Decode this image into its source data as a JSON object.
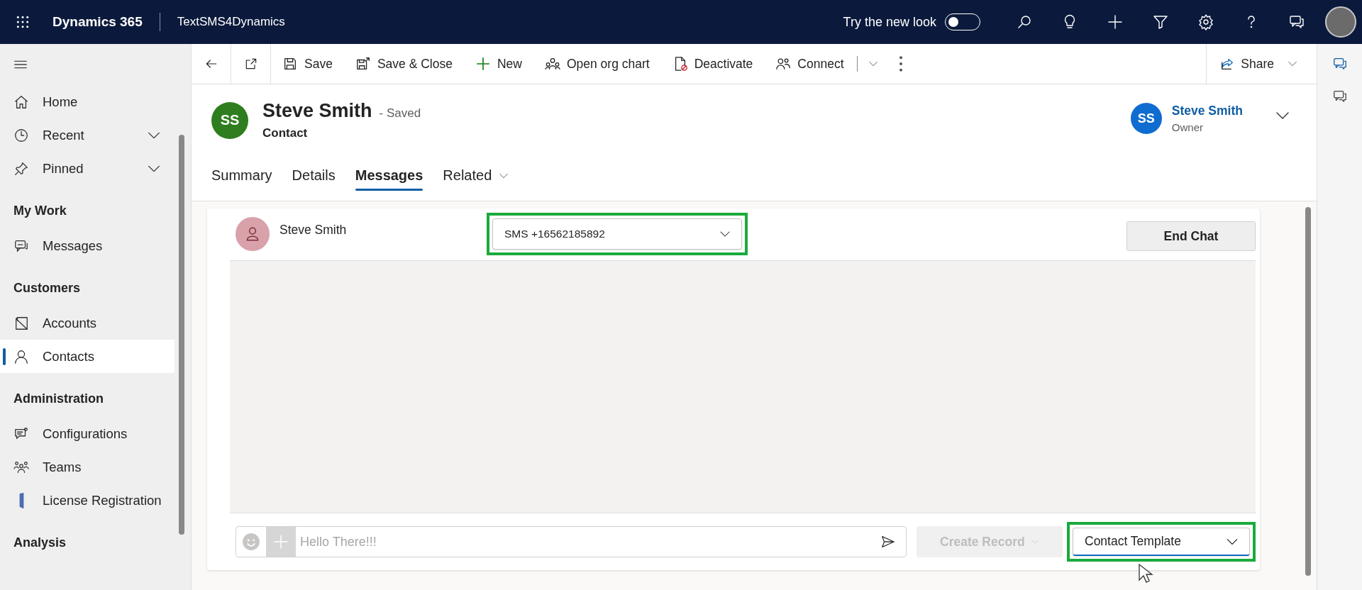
{
  "top_bar": {
    "app_name": "Dynamics 365",
    "app_title": "TextSMS4Dynamics",
    "new_look": {
      "label": "Try the new look",
      "on": false
    }
  },
  "command_bar": {
    "items": [
      {
        "label": "Save"
      },
      {
        "label": "Save & Close"
      },
      {
        "label": "New"
      },
      {
        "label": "Open org chart"
      },
      {
        "label": "Deactivate"
      },
      {
        "label": "Connect"
      }
    ],
    "share": "Share"
  },
  "sidebar": {
    "sections": [
      {
        "items": [
          {
            "label": "Home",
            "expandable": false,
            "selected": false
          },
          {
            "label": "Recent",
            "expandable": true,
            "selected": false
          },
          {
            "label": "Pinned",
            "expandable": true,
            "selected": false
          }
        ]
      },
      {
        "heading": "My Work",
        "items": [
          {
            "label": "Messages",
            "expandable": false,
            "selected": false
          }
        ]
      },
      {
        "heading": "Customers",
        "items": [
          {
            "label": "Accounts",
            "expandable": false,
            "selected": false
          },
          {
            "label": "Contacts",
            "expandable": false,
            "selected": true
          }
        ]
      },
      {
        "heading": "Administration",
        "items": [
          {
            "label": "Configurations",
            "expandable": false,
            "selected": false
          },
          {
            "label": "Teams",
            "expandable": false,
            "selected": false
          },
          {
            "label": "License Registration",
            "expandable": false,
            "selected": false
          }
        ]
      },
      {
        "heading": "Analysis"
      }
    ]
  },
  "record": {
    "initials": "SS",
    "name": "Steve Smith",
    "status": "- Saved",
    "type": "Contact",
    "owner": {
      "initials": "SS",
      "name": "Steve Smith",
      "role": "Owner"
    }
  },
  "tabs": [
    {
      "label": "Summary",
      "selected": false,
      "has_menu": false
    },
    {
      "label": "Details",
      "selected": false,
      "has_menu": false
    },
    {
      "label": "Messages",
      "selected": true,
      "has_menu": false
    },
    {
      "label": "Related",
      "selected": false,
      "has_menu": true
    }
  ],
  "chat": {
    "contact_name": "Steve Smith",
    "channel": {
      "value": "SMS +16562185892",
      "highlighted": true
    },
    "end_chat": "End Chat",
    "composer": {
      "placeholder": "Hello There!!!"
    },
    "create_record": {
      "label": "Create Record",
      "disabled": true
    },
    "template": {
      "value": "Contact Template",
      "highlighted": true
    }
  },
  "right_rail": [
    {
      "selected": true
    },
    {
      "selected": false
    }
  ]
}
